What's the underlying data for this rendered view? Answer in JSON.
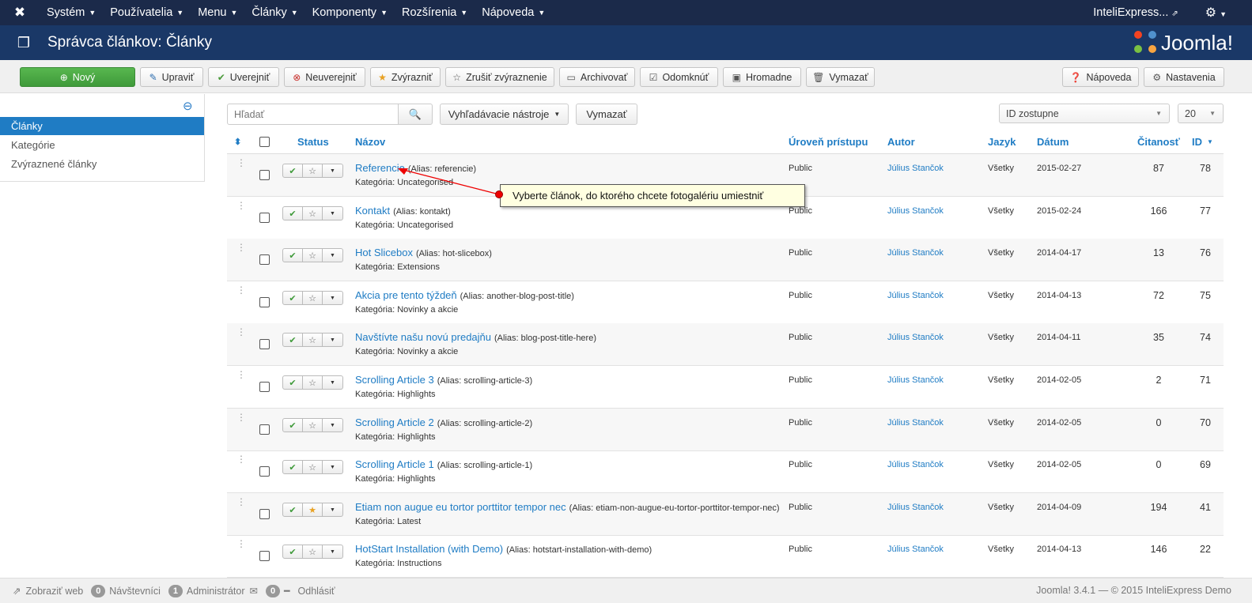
{
  "topnav": {
    "menu": [
      {
        "label": "Systém"
      },
      {
        "label": "Používatelia"
      },
      {
        "label": "Menu"
      },
      {
        "label": "Články"
      },
      {
        "label": "Komponenty"
      },
      {
        "label": "Rozšírenia"
      },
      {
        "label": "Nápoveda"
      }
    ],
    "site_name": "InteliExpress..."
  },
  "header": {
    "title": "Správca článkov: Články",
    "brand": "Joomla!"
  },
  "toolbar": {
    "new": "Nový",
    "edit": "Upraviť",
    "publish": "Uverejniť",
    "unpublish": "Neuverejniť",
    "feature": "Zvýrazniť",
    "unfeature": "Zrušiť zvýraznenie",
    "archive": "Archivovať",
    "checkin": "Odomknúť",
    "batch": "Hromadne",
    "trash": "Vymazať",
    "help": "Nápoveda",
    "options": "Nastavenia"
  },
  "sidebar": {
    "items": [
      {
        "label": "Články",
        "active": true
      },
      {
        "label": "Kategórie",
        "active": false
      },
      {
        "label": "Zvýraznené články",
        "active": false
      }
    ]
  },
  "filters": {
    "search_placeholder": "Hľadať",
    "search_tools": "Vyhľadávacie nástroje",
    "clear": "Vymazať",
    "ordering": "ID zostupne",
    "limit": "20"
  },
  "table": {
    "headers": {
      "status": "Status",
      "title": "Názov",
      "access": "Úroveň prístupu",
      "author": "Autor",
      "language": "Jazyk",
      "date": "Dátum",
      "hits": "Čitanosť",
      "id": "ID"
    },
    "category_prefix": "Kategória:",
    "rows": [
      {
        "title": "Referencie",
        "alias": "(Alias: referencie)",
        "category": "Uncategorised",
        "featured": false,
        "access": "Public",
        "author": "Július Stančok",
        "language": "Všetky",
        "date": "2015-02-27",
        "hits": "87",
        "id": "78"
      },
      {
        "title": "Kontakt",
        "alias": "(Alias: kontakt)",
        "category": "Uncategorised",
        "featured": false,
        "access": "Public",
        "author": "Július Stančok",
        "language": "Všetky",
        "date": "2015-02-24",
        "hits": "166",
        "id": "77"
      },
      {
        "title": "Hot Slicebox",
        "alias": "(Alias: hot-slicebox)",
        "category": "Extensions",
        "featured": false,
        "access": "Public",
        "author": "Július Stančok",
        "language": "Všetky",
        "date": "2014-04-17",
        "hits": "13",
        "id": "76"
      },
      {
        "title": "Akcia pre tento týždeň",
        "alias": "(Alias: another-blog-post-title)",
        "category": "Novinky a akcie",
        "featured": false,
        "access": "Public",
        "author": "Július Stančok",
        "language": "Všetky",
        "date": "2014-04-13",
        "hits": "72",
        "id": "75"
      },
      {
        "title": "Navštívte našu novú predajňu",
        "alias": "(Alias: blog-post-title-here)",
        "category": "Novinky a akcie",
        "featured": false,
        "access": "Public",
        "author": "Július Stančok",
        "language": "Všetky",
        "date": "2014-04-11",
        "hits": "35",
        "id": "74"
      },
      {
        "title": "Scrolling Article 3",
        "alias": "(Alias: scrolling-article-3)",
        "category": "Highlights",
        "featured": false,
        "access": "Public",
        "author": "Július Stančok",
        "language": "Všetky",
        "date": "2014-02-05",
        "hits": "2",
        "id": "71"
      },
      {
        "title": "Scrolling Article 2",
        "alias": "(Alias: scrolling-article-2)",
        "category": "Highlights",
        "featured": false,
        "access": "Public",
        "author": "Július Stančok",
        "language": "Všetky",
        "date": "2014-02-05",
        "hits": "0",
        "id": "70"
      },
      {
        "title": "Scrolling Article 1",
        "alias": "(Alias: scrolling-article-1)",
        "category": "Highlights",
        "featured": false,
        "access": "Public",
        "author": "Július Stančok",
        "language": "Všetky",
        "date": "2014-02-05",
        "hits": "0",
        "id": "69"
      },
      {
        "title": "Etiam non augue eu tortor porttitor tempor nec",
        "alias": "(Alias: etiam-non-augue-eu-tortor-porttitor-tempor-nec)",
        "category": "Latest",
        "featured": true,
        "access": "Public",
        "author": "Július Stančok",
        "language": "Všetky",
        "date": "2014-04-09",
        "hits": "194",
        "id": "41"
      },
      {
        "title": "HotStart Installation (with Demo)",
        "alias": "(Alias: hotstart-installation-with-demo)",
        "category": "Instructions",
        "featured": false,
        "access": "Public",
        "author": "Július Stančok",
        "language": "Všetky",
        "date": "2014-04-13",
        "hits": "146",
        "id": "22"
      }
    ]
  },
  "tooltip": {
    "text": "Vyberte článok, do ktorého chcete fotogalériu umiestniť"
  },
  "footer": {
    "view_site": "Zobraziť web",
    "visitors_count": "0",
    "visitors_label": "Návštevníci",
    "admins_count": "1",
    "admins_label": "Administrátor",
    "messages_count": "0",
    "logout": "Odhlásiť",
    "copyright": "Joomla! 3.4.1 — © 2015 InteliExpress Demo"
  }
}
